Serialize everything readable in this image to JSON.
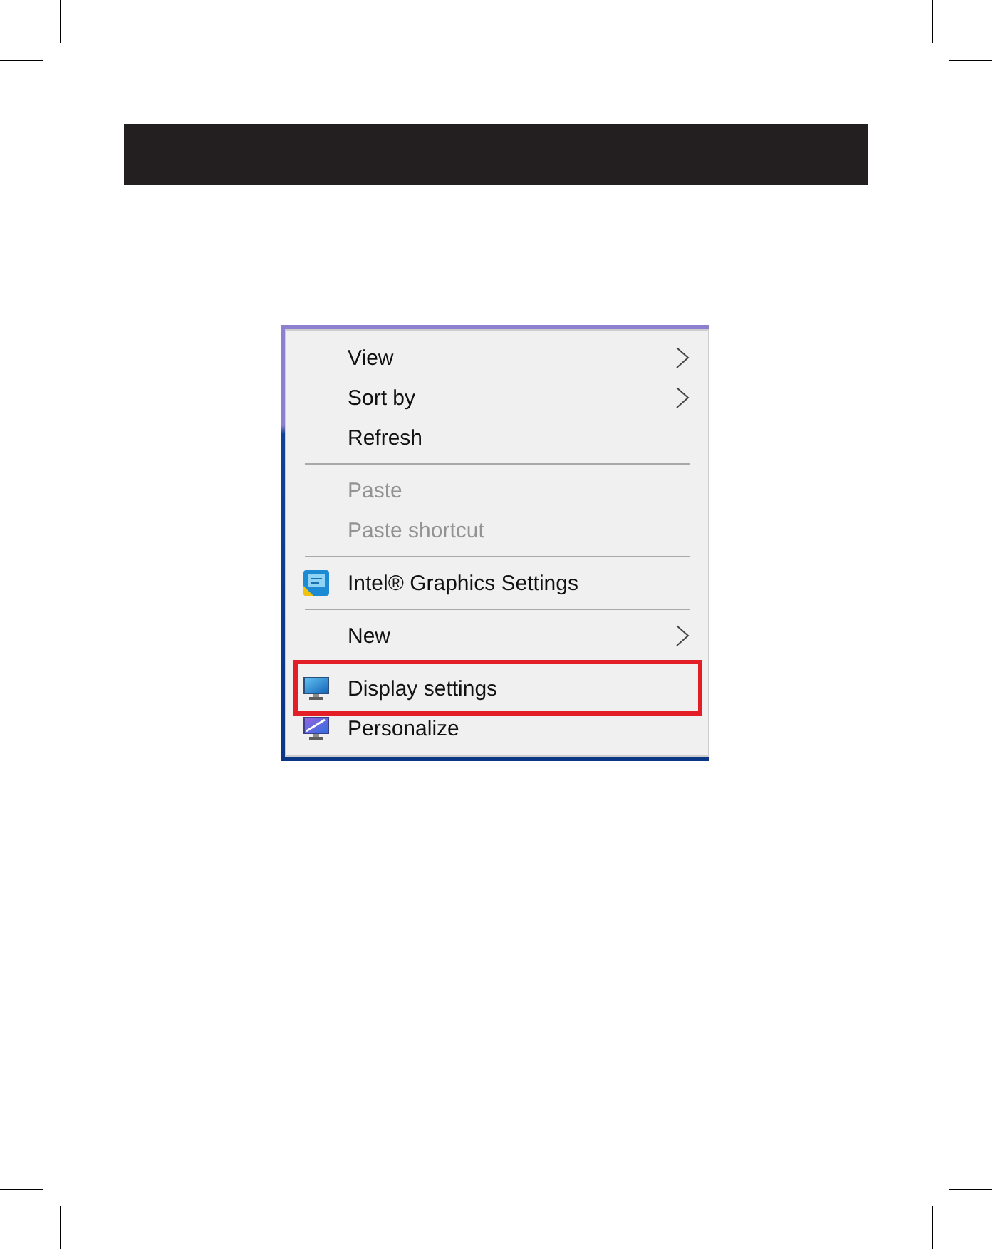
{
  "context_menu": {
    "sections": [
      {
        "items": [
          {
            "label": "View",
            "kind": "plain",
            "submenu": true,
            "disabled": false,
            "highlighted": false
          },
          {
            "label": "Sort by",
            "kind": "plain",
            "submenu": true,
            "disabled": false,
            "highlighted": false
          },
          {
            "label": "Refresh",
            "kind": "plain",
            "submenu": false,
            "disabled": false,
            "highlighted": false
          }
        ]
      },
      {
        "items": [
          {
            "label": "Paste",
            "kind": "plain",
            "submenu": false,
            "disabled": true,
            "highlighted": false
          },
          {
            "label": "Paste shortcut",
            "kind": "plain",
            "submenu": false,
            "disabled": true,
            "highlighted": false
          }
        ]
      },
      {
        "items": [
          {
            "label": "Intel® Graphics Settings",
            "kind": "graphics",
            "submenu": false,
            "disabled": false,
            "highlighted": false
          }
        ]
      },
      {
        "items": [
          {
            "label": "New",
            "kind": "plain",
            "submenu": true,
            "disabled": false,
            "highlighted": false
          }
        ]
      },
      {
        "items": [
          {
            "label": "Display settings",
            "kind": "display",
            "submenu": false,
            "disabled": false,
            "highlighted": true
          },
          {
            "label": "Personalize",
            "kind": "personalize",
            "submenu": false,
            "disabled": false,
            "highlighted": false
          }
        ]
      }
    ]
  }
}
